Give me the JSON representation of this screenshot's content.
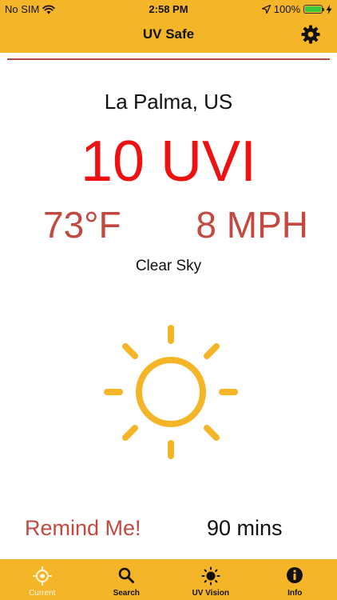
{
  "status_bar": {
    "carrier": "No SIM",
    "time": "2:58 PM",
    "battery_percent": "100%",
    "battery_level": 1.0
  },
  "nav": {
    "title": "UV Safe"
  },
  "weather": {
    "location": "La Palma, US",
    "uv_index": "10 UVI",
    "temperature": "73°F",
    "wind": "8 MPH",
    "condition": "Clear Sky"
  },
  "reminder": {
    "button_label": "Remind Me!",
    "duration": "90 mins"
  },
  "tabs": [
    {
      "label": "Current",
      "icon": "location-target-icon",
      "active": true
    },
    {
      "label": "Search",
      "icon": "search-icon",
      "active": false
    },
    {
      "label": "UV Vision",
      "icon": "sun-icon",
      "active": false
    },
    {
      "label": "Info",
      "icon": "info-icon",
      "active": false
    }
  ],
  "colors": {
    "accent": "#f5b529",
    "uvi": "#ee1111",
    "secondary_red": "#c3483f",
    "sun": "#f5b529"
  }
}
